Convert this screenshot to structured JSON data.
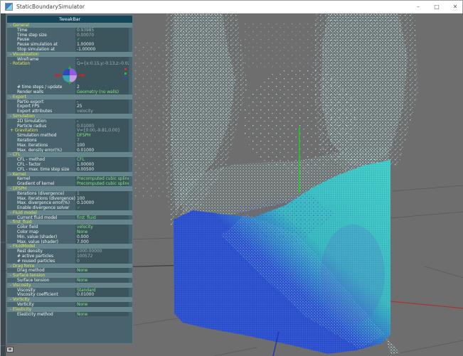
{
  "window": {
    "title": "StaticBoundarySimulator",
    "buttons": {
      "minimize": "–",
      "maximize": "□",
      "close": "✕"
    }
  },
  "tweakbar": {
    "title": "TweakBar",
    "rows": [
      {
        "h": 1,
        "y": 1,
        "pre": "-",
        "label": "General"
      },
      {
        "label": "Time",
        "value": "0.93985",
        "vc": "d"
      },
      {
        "label": "Time step size",
        "value": "0.00070",
        "vc": "d"
      },
      {
        "label": "Pause",
        "value": "✓",
        "vc": "c"
      },
      {
        "label": "Pause simulation at",
        "value": "1.00000",
        "vc": "n"
      },
      {
        "label": "Stop simulation at",
        "value": "-1.00000",
        "vc": "n"
      },
      {
        "h": 1,
        "y": 1,
        "pre": "-",
        "label": "Visualization"
      },
      {
        "label": "Wireframe",
        "value": "-",
        "vc": "n"
      },
      {
        "y": 1,
        "pre": "-",
        "label": "Rotation",
        "value": "Q={x:0.15,y:-0.13,z:-0.02,.",
        "vc": "d"
      },
      {
        "widget": "rotation"
      },
      {
        "label": "# time steps / update",
        "value": "2",
        "vc": "n"
      },
      {
        "label": "Render walls",
        "value": "Geometry (no walls)",
        "vc": "g"
      },
      {
        "h": 1,
        "y": 1,
        "pre": "-",
        "label": "Export"
      },
      {
        "label": "Partio export",
        "value": "-",
        "vc": "n"
      },
      {
        "label": "Export FPS",
        "value": "25",
        "vc": "n"
      },
      {
        "label": "Export attributes",
        "value": "velocity",
        "vc": "d"
      },
      {
        "h": 1,
        "y": 1,
        "pre": "-",
        "label": "Simulation"
      },
      {
        "label": "2D Simulation",
        "value": "-",
        "vc": "n"
      },
      {
        "label": "Particle radius",
        "value": "0.01000",
        "vc": "d"
      },
      {
        "y": 1,
        "pre": "+",
        "label": "Gravitation",
        "value": "V={0.00,-9.81,0.00}",
        "vc": "d"
      },
      {
        "label": "Simulation method",
        "value": "DFSPH",
        "vc": "g"
      },
      {
        "label": "Iterations",
        "value": "7",
        "vc": "d"
      },
      {
        "label": "Max. iterations",
        "value": "100",
        "vc": "n"
      },
      {
        "label": "Max. density error(%)",
        "value": "0.01000",
        "vc": "n"
      },
      {
        "h": 1,
        "y": 1,
        "pre": "-",
        "label": "CFL"
      },
      {
        "label": "CFL - method",
        "value": "CFL",
        "vc": "g"
      },
      {
        "label": "CFL - factor",
        "value": "1.00000",
        "vc": "n"
      },
      {
        "label": "CFL - max. time step size",
        "value": "0.00500",
        "vc": "n"
      },
      {
        "h": 1,
        "y": 1,
        "pre": "-",
        "label": "Kernel"
      },
      {
        "label": "Kernel",
        "value": "Precomputed cubic spline",
        "vc": "g"
      },
      {
        "label": "Gradient of kernel",
        "value": "Precomputed cubic spline",
        "vc": "g"
      },
      {
        "h": 1,
        "y": 1,
        "pre": "-",
        "label": "DFSPH"
      },
      {
        "label": "Iterations (divergence)",
        "value": "1",
        "vc": "d"
      },
      {
        "label": "Max. iterations (divergence)",
        "value": "100",
        "vc": "n"
      },
      {
        "label": "Max. divergence error(%)",
        "value": "0.10000",
        "vc": "n"
      },
      {
        "label": "Enable divergence solver",
        "value": "✓",
        "vc": "c"
      },
      {
        "h": 1,
        "y": 1,
        "pre": "-",
        "label": "Fluid model"
      },
      {
        "label": "Current fluid model",
        "value": "first_fluid",
        "vc": "g"
      },
      {
        "h": 1,
        "y": 1,
        "pre": "-",
        "label": "first_fluid"
      },
      {
        "label": "Color field",
        "value": "velocity",
        "vc": "g"
      },
      {
        "label": "Color map",
        "value": "None",
        "vc": "g"
      },
      {
        "label": "Min. value (shader)",
        "value": "0.000",
        "vc": "n"
      },
      {
        "label": "Max. value (shader)",
        "value": "7.000",
        "vc": "n"
      },
      {
        "h": 1,
        "y": 1,
        "pre": "-",
        "label": "FluidModel"
      },
      {
        "label": "Rest density",
        "value": "1000.00000",
        "vc": "d"
      },
      {
        "label": "# active particles",
        "value": "100572",
        "vc": "d"
      },
      {
        "label": "# reused particles",
        "value": "0",
        "vc": "d"
      },
      {
        "h": 1,
        "y": 1,
        "pre": "-",
        "label": "Drag force"
      },
      {
        "label": "Drag method",
        "value": "None",
        "vc": "g"
      },
      {
        "h": 1,
        "y": 1,
        "pre": "-",
        "label": "Surface tension"
      },
      {
        "label": "Surface tension",
        "value": "None",
        "vc": "g"
      },
      {
        "h": 1,
        "y": 1,
        "pre": "-",
        "label": "Viscosity"
      },
      {
        "label": "Viscosity",
        "value": "Standard",
        "vc": "g"
      },
      {
        "label": "Viscosity coefficient",
        "value": "0.01000",
        "vc": "n"
      },
      {
        "h": 1,
        "y": 1,
        "pre": "-",
        "label": "Vorticity"
      },
      {
        "label": "Vorticity",
        "value": "None",
        "vc": "g"
      },
      {
        "h": 1,
        "y": 1,
        "pre": "-",
        "label": "Elasticity"
      },
      {
        "label": "Elasticity method",
        "value": "None",
        "vc": "g"
      }
    ]
  },
  "scene": {
    "background": "#6e6e6e",
    "grid_color": "#5d5d5d",
    "x_axis_color": "#a53535",
    "y_axis_color": "#2bc32b",
    "z_axis_color": "#2535b0",
    "fluid_blue": "#2b50cf",
    "fluid_turquoise": "#41cdc8",
    "spray_color": "#b9e9ec"
  }
}
